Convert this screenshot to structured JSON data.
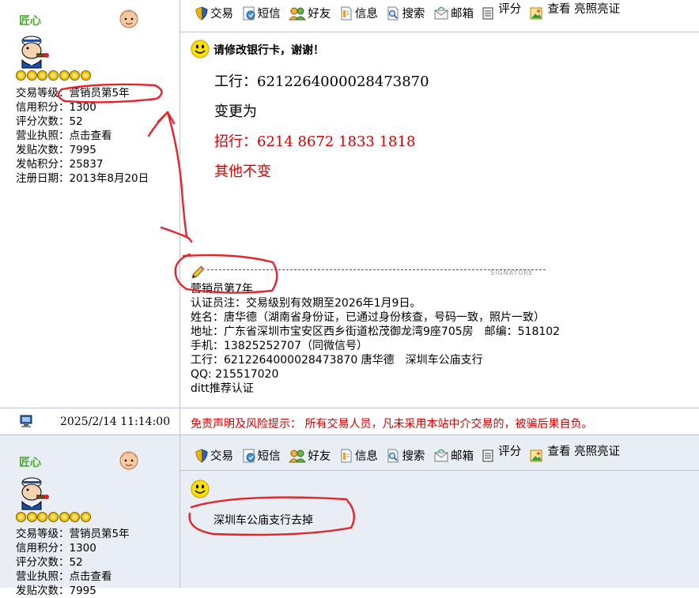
{
  "colors": {
    "username": "#4aa92a",
    "highlight_red": "#d40000",
    "annotation_red": "#e2242b",
    "border": "#b9c6d9",
    "reply_bg": "#e9edf4"
  },
  "toolbar": {
    "trade": "交易",
    "sms": "短信",
    "friend": "好友",
    "info": "信息",
    "search": "搜索",
    "mailbox": "邮箱",
    "rate": "评分",
    "view": "查看",
    "show_license": "亮照亮证"
  },
  "post1": {
    "user": {
      "name": "匠心",
      "star_count": 7,
      "info": [
        "交易等级：营销员第5年",
        "信用积分：1300",
        "评分次数：52",
        "营业执照：点击查看",
        "发贴次数：7995",
        "发帖积分：25837",
        "注册日期：2013年8月20日"
      ]
    },
    "title": "请修改银行卡，谢谢！",
    "lines": [
      "工行：6212264000028473870",
      "变更为",
      "招行：6214 8672 1833 1818",
      "其他不变"
    ],
    "signature_label": "SIGNATURE",
    "signature": [
      "营销员第7年",
      "认证员注：交易级别有效期至2026年1月9日。",
      "姓名：唐华德（湖南省身份证，已通过身份核查，号码一致，照片一致）",
      "地址：广东省深圳市宝安区西乡街道松茂御龙湾9座705房　邮编：518102",
      "手机：13825252707（同微信号）",
      "工行：6212264000028473870 唐华德　深圳车公庙支行",
      "QQ: 215517020",
      "ditt推荐认证"
    ]
  },
  "meta": {
    "time": "2025/2/14 11:14:00",
    "disclaimer": "免责声明及风险提示：  所有交易人员，凡未采用本站中介交易的，被骗后果自负。"
  },
  "post2": {
    "user": {
      "name": "匠心",
      "star_count": 7,
      "info": [
        "交易等级：营销员第5年",
        "信用积分：1300",
        "评分次数：52",
        "营业执照：点击查看",
        "发贴次数：7995"
      ]
    },
    "reply": "深圳车公庙支行去掉"
  }
}
